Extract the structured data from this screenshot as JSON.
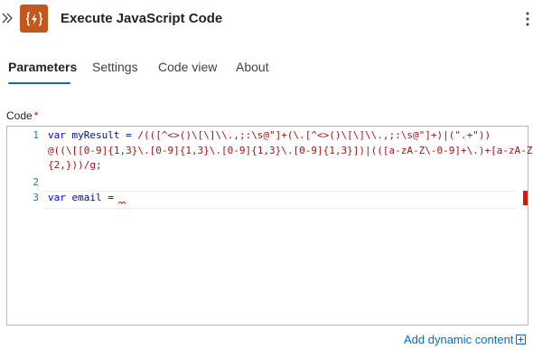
{
  "header": {
    "title": "Execute JavaScript Code",
    "action_icon_glyph": "{⚡}",
    "action_icon_color": "#c2581b"
  },
  "tabs": [
    {
      "label": "Parameters",
      "active": true
    },
    {
      "label": "Settings",
      "active": false
    },
    {
      "label": "Code view",
      "active": false
    },
    {
      "label": "About",
      "active": false
    }
  ],
  "code_field": {
    "label": "Code",
    "required_marker": "*",
    "lines": [
      {
        "number": "1",
        "keyword": "var",
        "name": " myResult = ",
        "text": "/(([^<>()\\[\\]\\\\.,;:\\s@\"]+(\\.[^<>()\\[\\]\\\\.,;:\\s@\"]+)|(\".+\"))"
      },
      {
        "number": "",
        "keyword": "",
        "name": "",
        "text": "@((\\[[0-9]{1,3}\\.[0-9]{1,3}\\.[0-9]{1,3}\\.[0-9]{1,3}])|(([a-zA-Z\\-0-9]+\\.)+[a-zA-Z]"
      },
      {
        "number": "",
        "keyword": "",
        "name": "",
        "text": "{2,}))/g;"
      },
      {
        "number": "2",
        "keyword": "",
        "name": "",
        "text": ""
      },
      {
        "number": "3",
        "keyword": "var",
        "name": " email =",
        "text": ""
      }
    ]
  },
  "footer": {
    "dynamic_content_label": "Add dynamic content"
  },
  "colors": {
    "accent": "#0f6cbd",
    "error": "#e51400",
    "required": "#c50f1f"
  }
}
